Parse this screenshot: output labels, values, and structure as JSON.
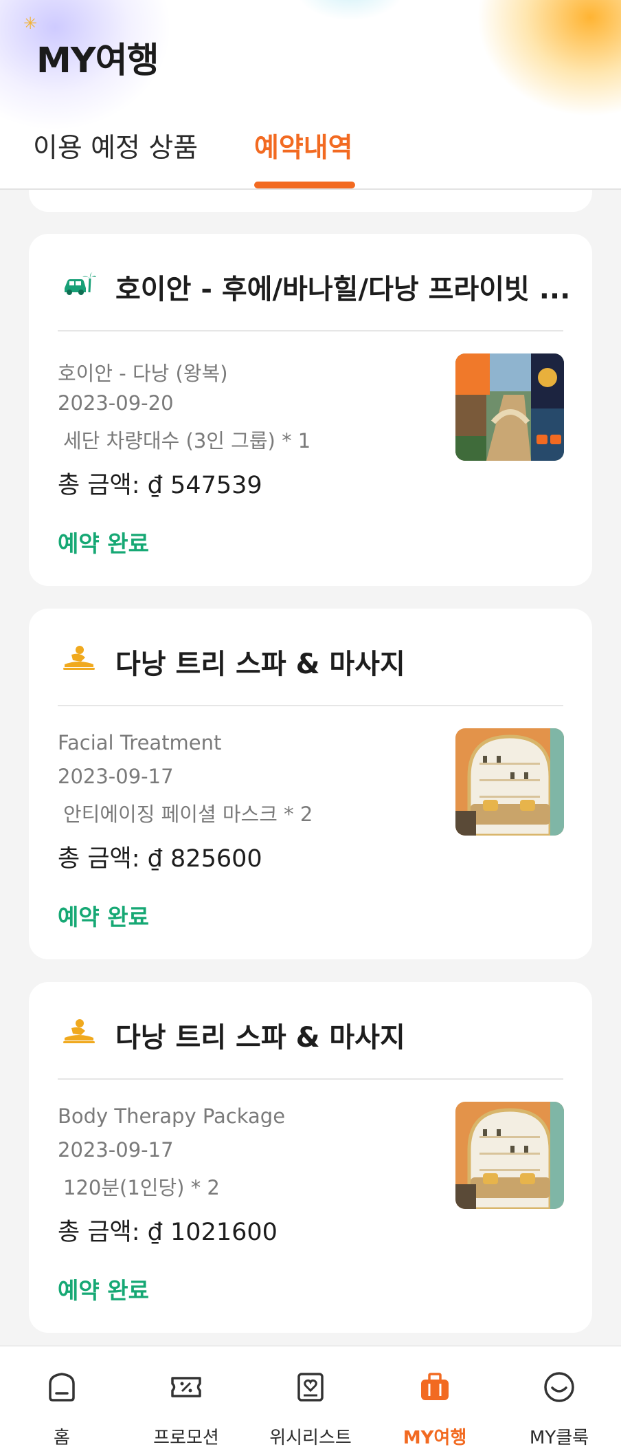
{
  "header": {
    "title": "MY여행",
    "tabs": [
      {
        "label": "이용 예정 상품",
        "active": false
      },
      {
        "label": "예약내역",
        "active": true
      }
    ]
  },
  "theme": {
    "accent": "#f26a21",
    "status_color": "#16a874",
    "background": "#f4f4f4"
  },
  "bookings": [
    {
      "category_icon": "car-palm-icon",
      "title": "호이안 - 후에/바나힐/다낭 프라이빗 ...",
      "product": "호이안 - 다낭 (왕복)",
      "date": "2023-09-20",
      "option": "세단 차량대수 (3인 그룹) * 1",
      "total": "총 금액: ₫ 547539",
      "status": "예약 완료",
      "thumbnail": "danang-tour-collage-image"
    },
    {
      "category_icon": "spa-massage-icon",
      "title": "다낭 트리 스파 & 마사지",
      "product": "Facial Treatment",
      "date": "2023-09-17",
      "option": "안티에이징 페이셜 마스크 * 2",
      "total": "총 금액: ₫ 825600",
      "status": "예약 완료",
      "thumbnail": "spa-lounge-image"
    },
    {
      "category_icon": "spa-massage-icon",
      "title": "다낭 트리 스파 & 마사지",
      "product": "Body Therapy Package",
      "date": "2023-09-17",
      "option": "120분(1인당) * 2",
      "total": "총 금액: ₫ 1021600",
      "status": "예약 완료",
      "thumbnail": "spa-lounge-image"
    }
  ],
  "bottom_nav": [
    {
      "label": "홈",
      "icon": "home-icon",
      "active": false
    },
    {
      "label": "프로모션",
      "icon": "promotion-ticket-icon",
      "active": false
    },
    {
      "label": "위시리스트",
      "icon": "wishlist-heart-icon",
      "active": false
    },
    {
      "label": "MY여행",
      "icon": "suitcase-icon",
      "active": true
    },
    {
      "label": "MY클룩",
      "icon": "smiley-profile-icon",
      "active": false
    }
  ]
}
